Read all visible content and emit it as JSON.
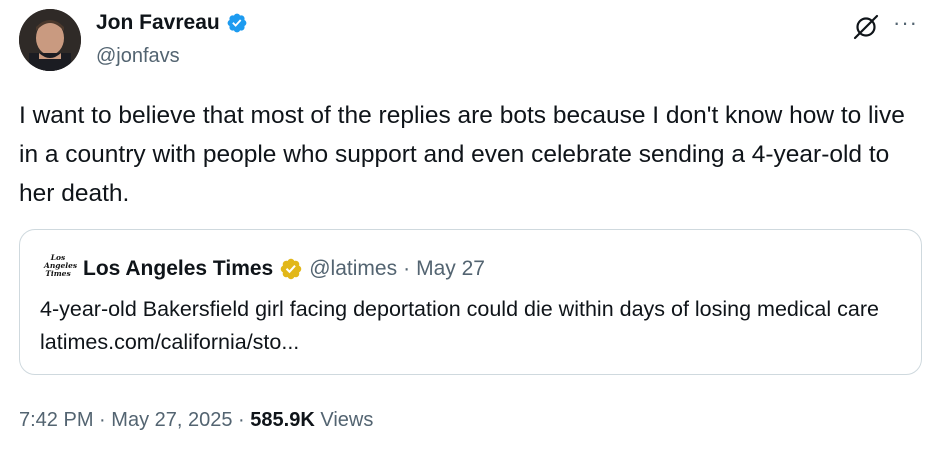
{
  "author": {
    "display_name": "Jon Favreau",
    "handle": "@jonfavs"
  },
  "colors": {
    "verified_blue": "#1d9bf0",
    "verified_gold": "#e2b719",
    "secondary_text": "#536471",
    "border": "#cfd9de"
  },
  "icons": {
    "verified": "verified-badge-icon",
    "grok": "grok-icon",
    "more": "more-options-icon"
  },
  "tweet": {
    "text": "I want to believe that most of the replies are bots because I don't know how to live in a country with people who support and even celebrate sending a 4-year-old to her death."
  },
  "quote": {
    "logo_text": "Los Angeles Times",
    "name": "Los Angeles Times",
    "handle": "@latimes",
    "separator": "·",
    "date": "May 27",
    "text": "4-year-old Bakersfield girl facing deportation could die within days of losing medical care latimes.com/california/sto..."
  },
  "meta": {
    "time": "7:42 PM",
    "separator": "·",
    "date": "May 27, 2025",
    "views_count": "585.9K",
    "views_label": "Views"
  }
}
